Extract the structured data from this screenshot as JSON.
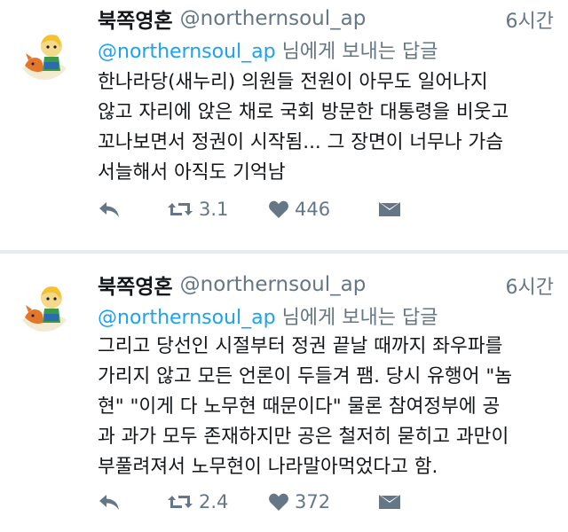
{
  "tweets": [
    {
      "display_name": "북쪽영혼",
      "handle": "@northernsoul_ap",
      "time": "6시간",
      "replying_handle": "@northernsoul_ap",
      "replying_suffix": " 님에게 보내는 답글",
      "lines": [
        "한나라당(새누리) 의원들 전원이 아무도 일어나지",
        "않고 자리에 앉은 채로 국회 방문한 대통령을 비웃고",
        "꼬나보면서 정권이 시작됨... 그 장면이 너무나 가슴",
        "서늘해서 아직도 기억남"
      ],
      "retweets": "3.1",
      "likes": "446"
    },
    {
      "display_name": "북쪽영혼",
      "handle": "@northernsoul_ap",
      "time": "6시간",
      "replying_handle": "@northernsoul_ap",
      "replying_suffix": " 님에게 보내는 답글",
      "lines": [
        "그리고 당선인 시절부터 정권 끝날 때까지 좌우파를",
        "가리지 않고 모든 언론이 두들겨 팸. 당시 유행어 \"놈",
        "현\" \"이게 다 노무현 때문이다\" 물론 참여정부에 공",
        "과 과가 모두 존재하지만 공은 철저히 묻히고 과만이",
        "부풀려져서 노무현이 나라말아먹었다고 함."
      ],
      "retweets": "2.4",
      "likes": "372"
    }
  ],
  "icons": {
    "reply": "reply-arrow-icon",
    "retweet": "retweet-icon",
    "like": "heart-icon",
    "dm": "envelope-icon"
  },
  "colors": {
    "link": "#1da1f2",
    "muted": "#657786",
    "text": "#14171a",
    "divider": "#e6ecf0"
  }
}
